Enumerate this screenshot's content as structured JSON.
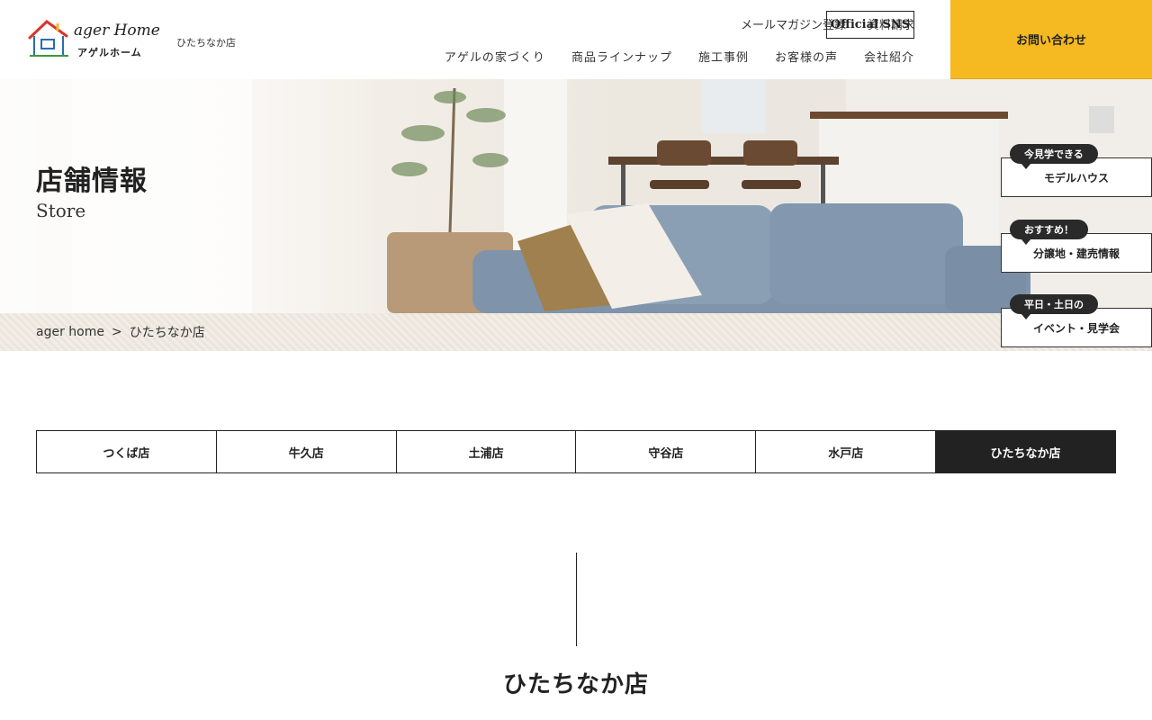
{
  "header": {
    "logo_script": "ager Home",
    "logo_kana": "アゲルホーム",
    "store_tag": "ひたちなか店",
    "sub_nav": [
      "メールマガジン登録",
      "資料請求"
    ],
    "sns_label": "Official SNS",
    "main_nav": [
      "アゲルの家づくり",
      "商品ラインナップ",
      "施工事例",
      "お客様の声",
      "会社紹介"
    ],
    "contact_label": "お問い合わせ"
  },
  "hero": {
    "title": "店舗情報",
    "subtitle": "Store"
  },
  "breadcrumb": {
    "home": "ager home",
    "separator": ">",
    "current": "ひたちなか店"
  },
  "side_badges": [
    {
      "pill": "今見学できる",
      "label": "モデルハウス"
    },
    {
      "pill": "おすすめ！",
      "label": "分譲地・建売情報"
    },
    {
      "pill": "平日・土日の",
      "label": "イベント・見学会"
    }
  ],
  "tabs": [
    "つくば店",
    "牛久店",
    "土浦店",
    "守谷店",
    "水戸店",
    "ひたちなか店"
  ],
  "active_tab": "ひたちなか店",
  "section": {
    "title": "ひたちなか店"
  },
  "colors": {
    "accent": "#f5b921",
    "dark": "#222222"
  }
}
